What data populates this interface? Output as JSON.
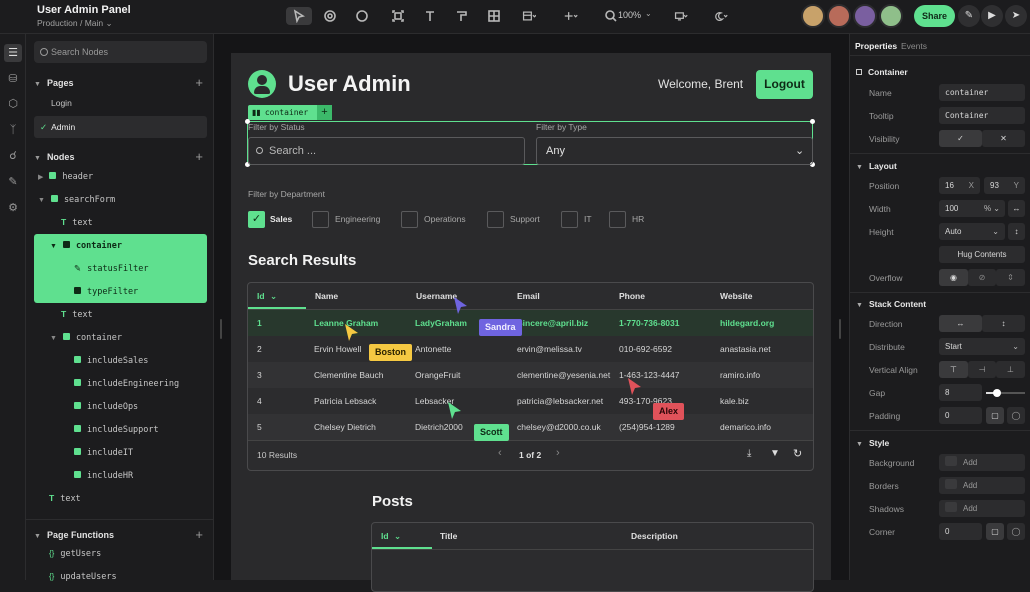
{
  "app": {
    "title": "User Admin Panel",
    "subtitle": "Production  /  Main ⌄"
  },
  "toolbar": {
    "zoom": "100%",
    "share_label": "Share"
  },
  "left_panel": {
    "search_placeholder": "Search Nodes",
    "pages_header": "Pages",
    "pages": [
      "Login",
      "Admin"
    ],
    "nodes_header": "Nodes",
    "nodes": {
      "header": "header",
      "searchForm": "searchForm",
      "text1": "text",
      "container": "container",
      "statusFilter": "statusFilter",
      "typeFilter": "typeFilter",
      "text2": "text",
      "container2": "container",
      "includeSales": "includeSales",
      "includeEngineering": "includeEngineering",
      "includeOps": "includeOps",
      "includeSupport": "includeSupport",
      "includeIT": "includeIT",
      "includeHR": "includeHR",
      "text3": "text"
    },
    "functions_header": "Page Functions",
    "functions": [
      "getUsers",
      "updateUsers"
    ]
  },
  "canvas": {
    "page_title": "User Admin",
    "welcome": "Welcome, Brent",
    "logout": "Logout",
    "container_tag": "container",
    "status_label": "Filter by Status",
    "search_placeholder": "Search ...",
    "type_label": "Filter by Type",
    "type_value": "Any",
    "dept_label": "Filter by Department",
    "departments": [
      "Sales",
      "Engineering",
      "Operations",
      "Support",
      "IT",
      "HR"
    ],
    "results_title": "Search Results",
    "columns": [
      "Id",
      "Name",
      "Username",
      "Email",
      "Phone",
      "Website"
    ],
    "rows": [
      [
        "1",
        "Leanne Graham",
        "LadyGraham",
        "Sincere@april.biz",
        "1-770-736-8031",
        "hildegard.org"
      ],
      [
        "2",
        "Ervin Howell",
        "Antonette",
        "ervin@melissa.tv",
        "010-692-6592",
        "anastasia.net"
      ],
      [
        "3",
        "Clementine Bauch",
        "OrangeFruit",
        "clementine@yesenia.net",
        "1-463-123-4447",
        "ramiro.info"
      ],
      [
        "4",
        "Patricia Lebsack",
        "Lebsacker",
        "patricia@lebsacker.net",
        "493-170-9623",
        "kale.biz"
      ],
      [
        "5",
        "Chelsey Dietrich",
        "Dietrich2000",
        "chelsey@d2000.co.uk",
        "(254)954-1289",
        "demarico.info"
      ]
    ],
    "results_count": "10 Results",
    "pagination": "1 of 2",
    "posts_title": "Posts",
    "posts_columns": [
      "Id",
      "Title",
      "Description"
    ]
  },
  "cursors": [
    {
      "name": "Boston",
      "color": "#f5c842"
    },
    {
      "name": "Sandra",
      "color": "#6f64e0"
    },
    {
      "name": "Alex",
      "color": "#e0525a"
    },
    {
      "name": "Scott",
      "color": "#5fe08f"
    }
  ],
  "right_panel": {
    "tabs": [
      "Properties",
      "Events"
    ],
    "container_header": "Container",
    "name_label": "Name",
    "name_value": "container",
    "tooltip_label": "Tooltip",
    "tooltip_value": "Container",
    "visibility_label": "Visibility",
    "layout_header": "Layout",
    "position_label": "Position",
    "pos_x": "16",
    "pos_x_unit": "X",
    "pos_y": "93",
    "pos_y_unit": "Y",
    "width_label": "Width",
    "width_value": "100",
    "width_unit": "% ⌄",
    "height_label": "Height",
    "height_value": "Auto",
    "hug_label": "Hug Contents",
    "overflow_label": "Overflow",
    "stack_header": "Stack Content",
    "direction_label": "Direction",
    "distribute_label": "Distribute",
    "distribute_value": "Start",
    "valign_label": "Vertical Align",
    "gap_label": "Gap",
    "gap_value": "8",
    "padding_label": "Padding",
    "padding_value": "0",
    "style_header": "Style",
    "background_label": "Background",
    "borders_label": "Borders",
    "shadows_label": "Shadows",
    "add_label": "Add",
    "corner_label": "Corner",
    "corner_value": "0"
  },
  "colors": {
    "accent": "#5fe08f",
    "canvas_bg": "#151517",
    "frame_bg": "#2a2a2c"
  }
}
